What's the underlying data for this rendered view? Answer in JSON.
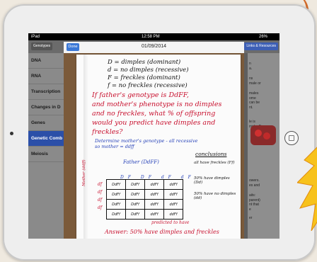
{
  "status_bar": {
    "carrier": "iPad",
    "time": "12:58 PM",
    "battery": "26%"
  },
  "nav": {
    "left_button": "Genotypes",
    "right_button": "Links & Resources"
  },
  "sidebar": {
    "items": [
      {
        "label": "DNA",
        "active": false
      },
      {
        "label": "RNA",
        "active": false
      },
      {
        "label": "Transcription",
        "active": false
      },
      {
        "label": "Changes in D",
        "active": false
      },
      {
        "label": "Genes",
        "active": false
      },
      {
        "label": "Genetic Comb",
        "active": true
      },
      {
        "label": "Meiosis",
        "active": false
      }
    ]
  },
  "content_fragments": [
    "n",
    "a.",
    "ns",
    "male or",
    "males",
    "ome",
    "can be",
    "nt.",
    "le is",
    "mple: R",
    "owers.",
    "es and",
    "aits:",
    "parent)",
    "nt that",
    "e",
    "er"
  ],
  "modal": {
    "done_label": "Done",
    "title": "01/09/2014"
  },
  "notebook": {
    "definitions": [
      "D = dimples (dominant)",
      "d = no dimples (recessive)",
      "F = freckles (dominant)",
      "f = no freckles (recessive)"
    ],
    "question": [
      "If father's genotype is DdFF,",
      "and mother's phenotype is no dimples",
      "and no freckles, what % of offspring",
      "would you predict have dimples and",
      "freckles?"
    ],
    "note": [
      "Determine mother's genotype - all recessive",
      "so mother = ddff"
    ],
    "punnett": {
      "header": "Father (DdFF)",
      "father_gametes": [
        "DF",
        "DF",
        "dF",
        "dF"
      ],
      "mother_gametes": [
        "df",
        "df",
        "df",
        "df"
      ],
      "rows": [
        [
          "DdFf",
          "DdFf",
          "ddFf",
          "ddFf"
        ],
        [
          "DdFf",
          "DdFf",
          "ddFf",
          "ddFf"
        ],
        [
          "DdFf",
          "DdFf",
          "ddFf",
          "ddFf"
        ],
        [
          "DdFf",
          "DdFf",
          "ddFf",
          "ddFf"
        ]
      ],
      "side_label": "Mother (ddff)"
    },
    "conclusions_title": "conclusions",
    "conclusions": [
      "all have freckles (Ff)",
      "50% have dimples (Dd)",
      "50% have no dimples (dd)"
    ],
    "predicted": "predicted to have",
    "answer": "Answer: 50% have dimples and freckles"
  },
  "colors": {
    "sidebar_active": "#2b4fa8",
    "done_button": "#3b78d6",
    "ink_red": "#c8102e",
    "ink_blue": "#2742b8"
  }
}
